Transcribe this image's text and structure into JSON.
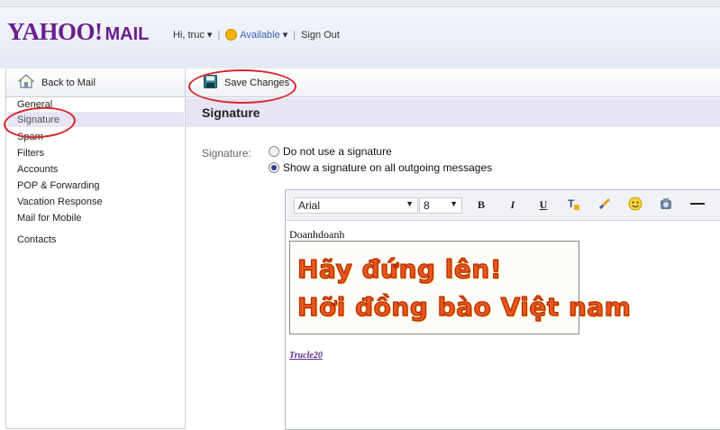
{
  "header": {
    "logo_text": "YAHOO!",
    "logo_mail": "MAIL",
    "greeting": "Hi, truc",
    "greeting_menu_arrow": "▾",
    "status": "Available",
    "status_arrow": "▾",
    "sign_out": "Sign Out",
    "sep1": "|",
    "sep2": "|"
  },
  "sidebar": {
    "back_label": "Back to Mail",
    "back_icon": "house-icon",
    "items": [
      {
        "label": "General"
      },
      {
        "label": "Signature"
      },
      {
        "label": "Spam"
      },
      {
        "label": "Filters"
      },
      {
        "label": "Accounts"
      },
      {
        "label": "POP & Forwarding"
      },
      {
        "label": "Vacation Response"
      },
      {
        "label": "Mail for Mobile"
      },
      {
        "label": "Contacts"
      }
    ]
  },
  "toolbar": {
    "save_label": "Save Changes",
    "save_icon": "floppy-disk-icon"
  },
  "main": {
    "title": "Signature",
    "field_label": "Signature:",
    "radio_options": [
      {
        "label": "Do not use a signature",
        "selected": false
      },
      {
        "label": "Show a signature on all outgoing messages",
        "selected": true
      }
    ]
  },
  "editor": {
    "font_value": "Arial",
    "size_value": "8",
    "dropdown_arrow": "▼",
    "bold": "B",
    "italic": "I",
    "underline": "U",
    "signature_name": "Doanhdoanh",
    "image_line1": "Hãy đứng lên!",
    "image_line2": "Hỡi đồng bào Việt nam",
    "link_text": "Trucle20"
  },
  "colors": {
    "brand": "#6b1e8c",
    "title_bar": "#e7e4f3",
    "annotation": "#d8262b"
  }
}
